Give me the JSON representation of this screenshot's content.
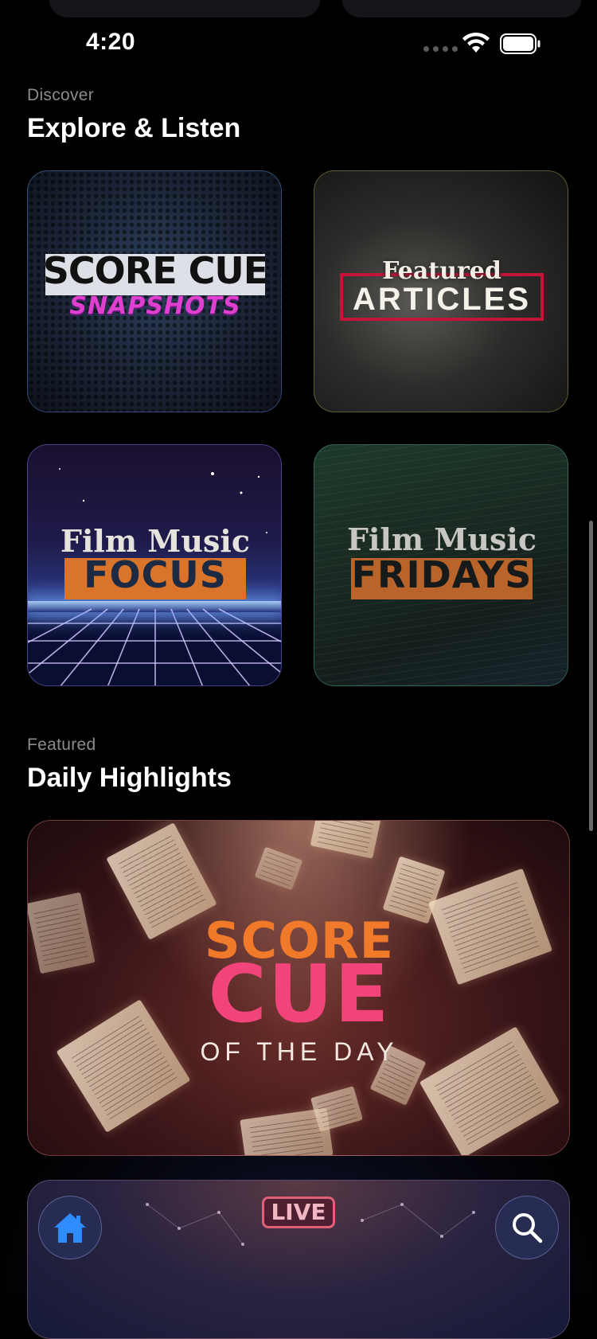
{
  "status_bar": {
    "time": "4:20"
  },
  "sections": {
    "discover": {
      "eyebrow": "Discover",
      "title": "Explore & Listen"
    },
    "featured": {
      "eyebrow": "Featured",
      "title": "Daily Highlights"
    }
  },
  "tiles": {
    "snapshots": {
      "title": "SCORE CUE",
      "subtitle": "SNAPSHOTS"
    },
    "articles": {
      "top": "Featured",
      "main": "ARTICLES"
    },
    "focus": {
      "top": "Film Music",
      "main": "FOCUS"
    },
    "fridays": {
      "top": "Film Music",
      "main": "FRIDAYS"
    }
  },
  "highlight": {
    "line1": "SCORE",
    "line2": "CUE",
    "line3": "OF THE DAY"
  },
  "live_card": {
    "badge": "LIVE"
  },
  "icons": {
    "home": "home-icon",
    "search": "search-icon",
    "wifi": "wifi-icon",
    "battery": "battery-icon"
  },
  "colors": {
    "background": "#000000",
    "accent_blue": "#2f8cff",
    "secondary_text": "#8c8c90"
  }
}
